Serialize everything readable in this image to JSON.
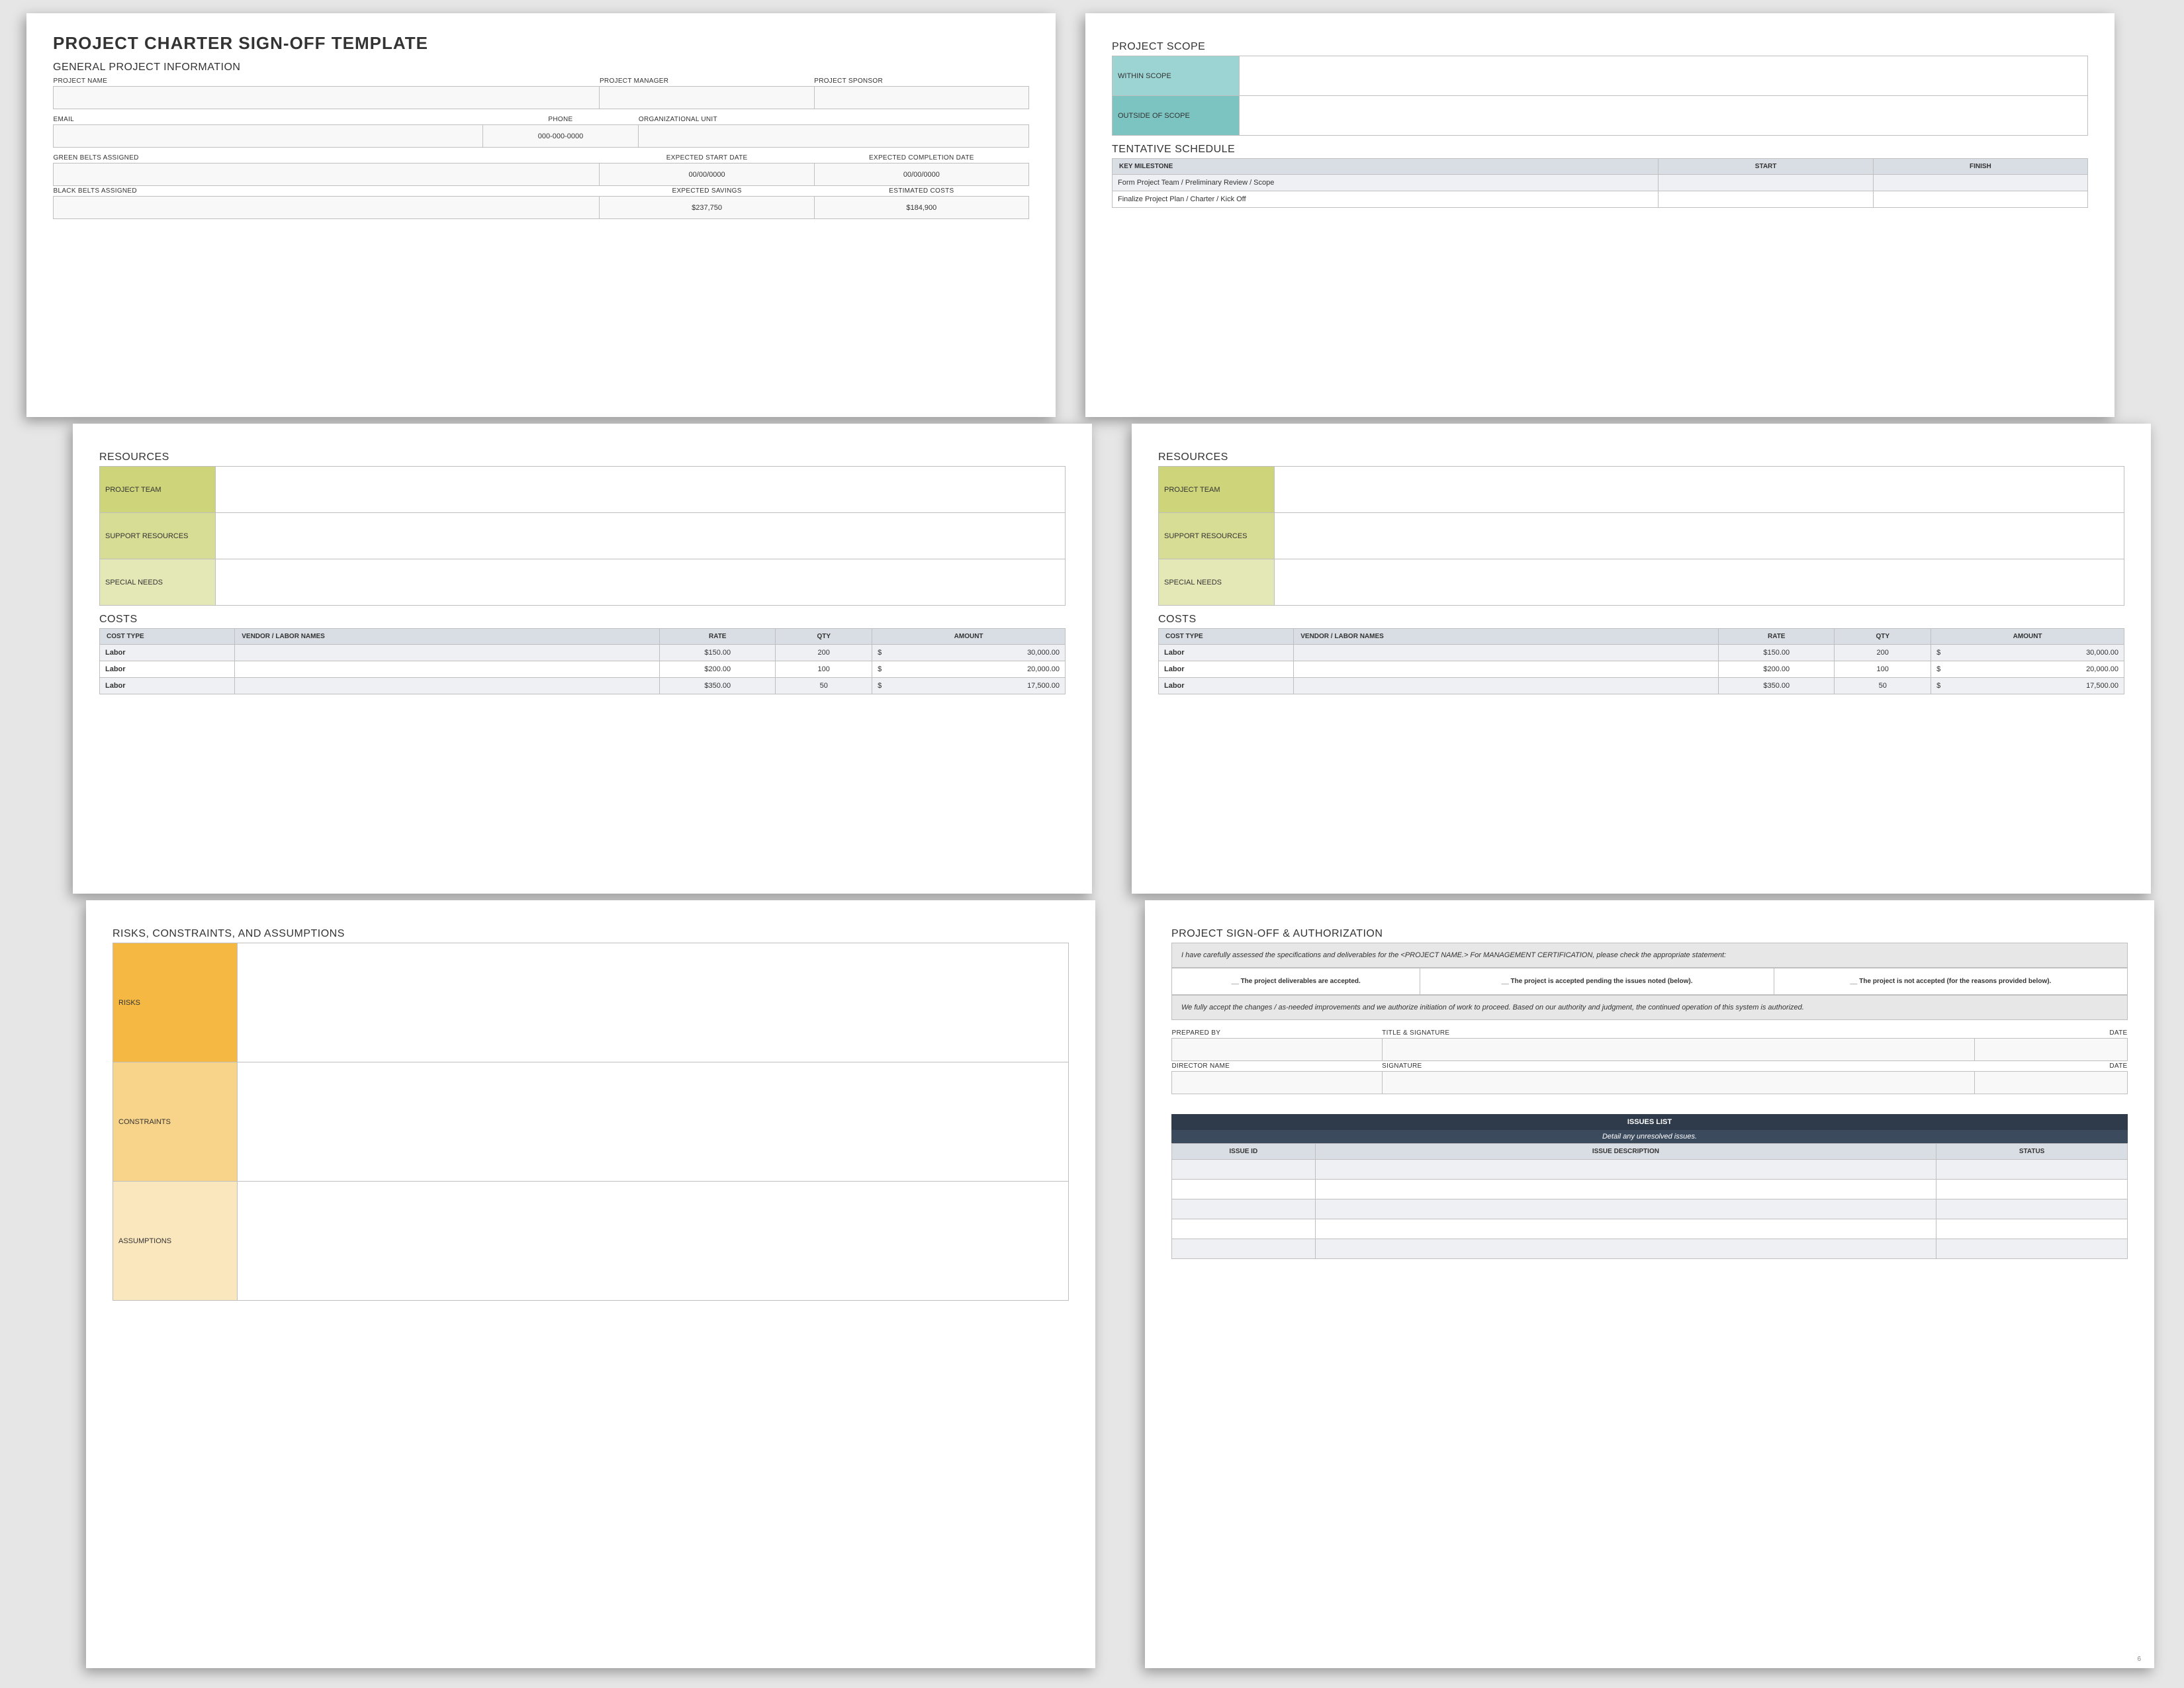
{
  "title": "PROJECT CHARTER SIGN-OFF TEMPLATE",
  "page_number": "6",
  "general": {
    "heading": "GENERAL PROJECT INFORMATION",
    "labels": {
      "project_name": "PROJECT NAME",
      "project_manager": "PROJECT MANAGER",
      "project_sponsor": "PROJECT SPONSOR",
      "email": "EMAIL",
      "phone": "PHONE",
      "org_unit": "ORGANIZATIONAL UNIT",
      "green_belts": "GREEN BELTS ASSIGNED",
      "expected_start": "EXPECTED START DATE",
      "expected_completion": "EXPECTED COMPLETION DATE",
      "black_belts": "BLACK BELTS ASSIGNED",
      "expected_savings": "EXPECTED SAVINGS",
      "estimated_costs": "ESTIMATED COSTS"
    },
    "values": {
      "phone": "000-000-0000",
      "expected_start": "00/00/0000",
      "expected_completion": "00/00/0000",
      "expected_savings": "$237,750",
      "estimated_costs": "$184,900"
    }
  },
  "scope": {
    "heading": "PROJECT SCOPE",
    "within": "WITHIN SCOPE",
    "outside": "OUTSIDE OF SCOPE"
  },
  "schedule": {
    "heading": "TENTATIVE SCHEDULE",
    "cols": {
      "milestone": "KEY MILESTONE",
      "start": "START",
      "finish": "FINISH"
    },
    "rows": [
      "Form Project Team / Preliminary Review / Scope",
      "Finalize Project Plan / Charter / Kick Off"
    ]
  },
  "resources": {
    "heading": "RESOURCES",
    "project_team": "PROJECT TEAM",
    "support": "SUPPORT RESOURCES",
    "special": "SPECIAL NEEDS"
  },
  "costs": {
    "heading": "COSTS",
    "cols": {
      "type": "COST TYPE",
      "vendor": "VENDOR / LABOR NAMES",
      "rate": "RATE",
      "qty": "QTY",
      "amount": "AMOUNT"
    },
    "rows": [
      {
        "type": "Labor",
        "rate": "$150.00",
        "qty": "200",
        "amount_cur": "$",
        "amount": "30,000.00"
      },
      {
        "type": "Labor",
        "rate": "$200.00",
        "qty": "100",
        "amount_cur": "$",
        "amount": "20,000.00"
      },
      {
        "type": "Labor",
        "rate": "$350.00",
        "qty": "50",
        "amount_cur": "$",
        "amount": "17,500.00"
      }
    ]
  },
  "risks": {
    "heading": "RISKS, CONSTRAINTS, AND ASSUMPTIONS",
    "risks": "RISKS",
    "constraints": "CONSTRAINTS",
    "assumptions": "ASSUMPTIONS"
  },
  "signoff": {
    "heading": "PROJECT SIGN-OFF & AUTHORIZATION",
    "intro": "I have carefully assessed the specifications and deliverables for the <PROJECT NAME.> For MANAGEMENT CERTIFICATION, please check the appropriate statement:",
    "opt1": "__ The project deliverables are accepted.",
    "opt2": "__ The project is accepted pending the issues noted (below).",
    "opt3": "__ The project is not accepted (for the reasons provided below).",
    "accept": "We fully accept the changes / as-needed improvements and we authorize initiation of work to proceed. Based on our authority and judgment, the continued operation of this system is authorized.",
    "labels": {
      "prepared_by": "PREPARED BY",
      "title_sig": "TITLE & SIGNATURE",
      "date": "DATE",
      "director": "DIRECTOR NAME",
      "signature": "SIGNATURE"
    },
    "issues": {
      "title": "ISSUES LIST",
      "sub": "Detail any unresolved issues.",
      "cols": {
        "id": "ISSUE ID",
        "desc": "ISSUE DESCRIPTION",
        "status": "STATUS"
      }
    }
  }
}
